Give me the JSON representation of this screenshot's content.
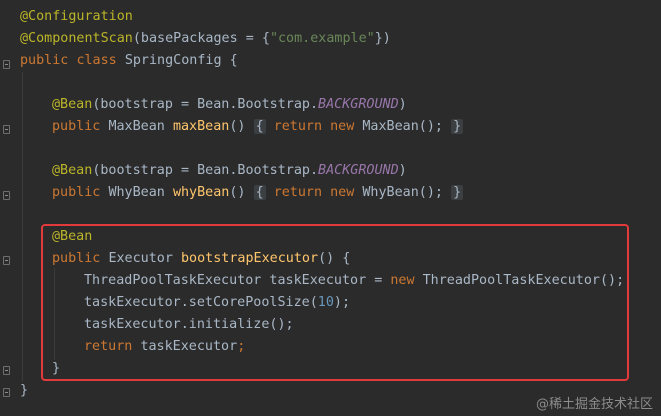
{
  "code": {
    "l1": {
      "ann": "@Configuration"
    },
    "l2": {
      "ann": "@ComponentScan",
      "p1": "(basePackages = {",
      "str": "\"com.example\"",
      "p2": "})"
    },
    "l3": {
      "kw1": "public",
      "kw2": "class",
      "p1": "SpringConfig {"
    },
    "l5": {
      "ann": "@Bean",
      "p1": "(bootstrap = Bean.Bootstrap.",
      "const": "BACKGROUND",
      "p2": ")"
    },
    "l6": {
      "kw1": "public",
      "type": "MaxBean",
      "fn": "maxBean",
      "p1": "()",
      "brace1": "{",
      "kw2": "return",
      "kw3": "new",
      "p2": "MaxBean();",
      "brace2": "}"
    },
    "l8": {
      "ann": "@Bean",
      "p1": "(bootstrap = Bean.Bootstrap.",
      "const": "BACKGROUND",
      "p2": ")"
    },
    "l9": {
      "kw1": "public",
      "type": "WhyBean",
      "fn": "whyBean",
      "p1": "()",
      "brace1": "{",
      "kw2": "return",
      "kw3": "new",
      "p2": "WhyBean();",
      "brace2": "}"
    },
    "l11": {
      "ann": "@Bean"
    },
    "l12": {
      "kw1": "public",
      "type": "Executor",
      "fn": "bootstrapExecutor",
      "p1": "() {"
    },
    "l13": {
      "p1": "ThreadPoolTaskExecutor taskExecutor = ",
      "kw": "new",
      "p2": "ThreadPoolTaskExecutor();"
    },
    "l14": {
      "p1": "taskExecutor.setCorePoolSize(",
      "num": "10",
      "p2": ");"
    },
    "l15": {
      "p1": "taskExecutor.initialize();"
    },
    "l16": {
      "kw": "return",
      "p1": "taskExecutor",
      "semi": ";"
    },
    "l17": {
      "p1": "}"
    },
    "l18": {
      "p1": "}"
    }
  },
  "watermark": "@稀土掘金技术社区",
  "colors": {
    "background": "#2b2b2b",
    "annotation": "#bbb529",
    "keyword": "#cc7832",
    "string": "#6a8759",
    "method": "#ffc66d",
    "constant": "#9876aa",
    "number": "#6897bb",
    "text": "#a9b7c6",
    "highlight_box": "#e23a3a"
  }
}
